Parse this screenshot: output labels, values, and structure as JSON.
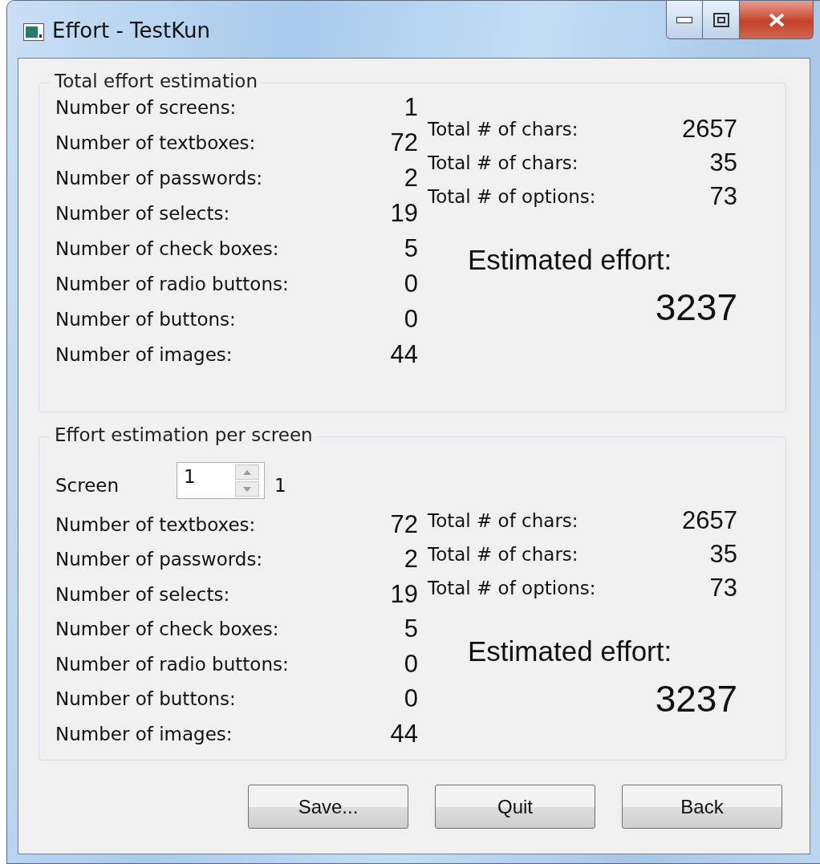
{
  "window": {
    "title": "Effort - TestKun"
  },
  "total": {
    "title": "Total effort estimation",
    "counts": [
      {
        "label": "Number of screens:",
        "value": "1"
      },
      {
        "label": "Number of textboxes:",
        "value": "72"
      },
      {
        "label": "Number of passwords:",
        "value": "2"
      },
      {
        "label": "Number of selects:",
        "value": "19"
      },
      {
        "label": "Number of check boxes:",
        "value": "5"
      },
      {
        "label": "Number of radio buttons:",
        "value": "0"
      },
      {
        "label": "Number of buttons:",
        "value": "0"
      },
      {
        "label": "Number of images:",
        "value": "44"
      }
    ],
    "totals": [
      {
        "label": "Total # of chars:",
        "value": "2657"
      },
      {
        "label": "Total # of chars:",
        "value": "35"
      },
      {
        "label": "Total # of options:",
        "value": "73"
      }
    ],
    "effort_label": "Estimated effort:",
    "effort_value": "3237"
  },
  "per_screen": {
    "title": "Effort estimation per screen",
    "screen_label": "Screen",
    "spin_value": "1",
    "screen_count": "1",
    "counts": [
      {
        "label": "Number of textboxes:",
        "value": "72"
      },
      {
        "label": "Number of passwords:",
        "value": "2"
      },
      {
        "label": "Number of selects:",
        "value": "19"
      },
      {
        "label": "Number of check boxes:",
        "value": "5"
      },
      {
        "label": "Number of radio buttons:",
        "value": "0"
      },
      {
        "label": "Number of buttons:",
        "value": "0"
      },
      {
        "label": "Number of images:",
        "value": "44"
      }
    ],
    "totals": [
      {
        "label": "Total # of chars:",
        "value": "2657"
      },
      {
        "label": "Total # of chars:",
        "value": "35"
      },
      {
        "label": "Total # of options:",
        "value": "73"
      }
    ],
    "effort_label": "Estimated effort:",
    "effort_value": "3237"
  },
  "buttons": [
    "Save...",
    "Quit",
    "Back"
  ]
}
